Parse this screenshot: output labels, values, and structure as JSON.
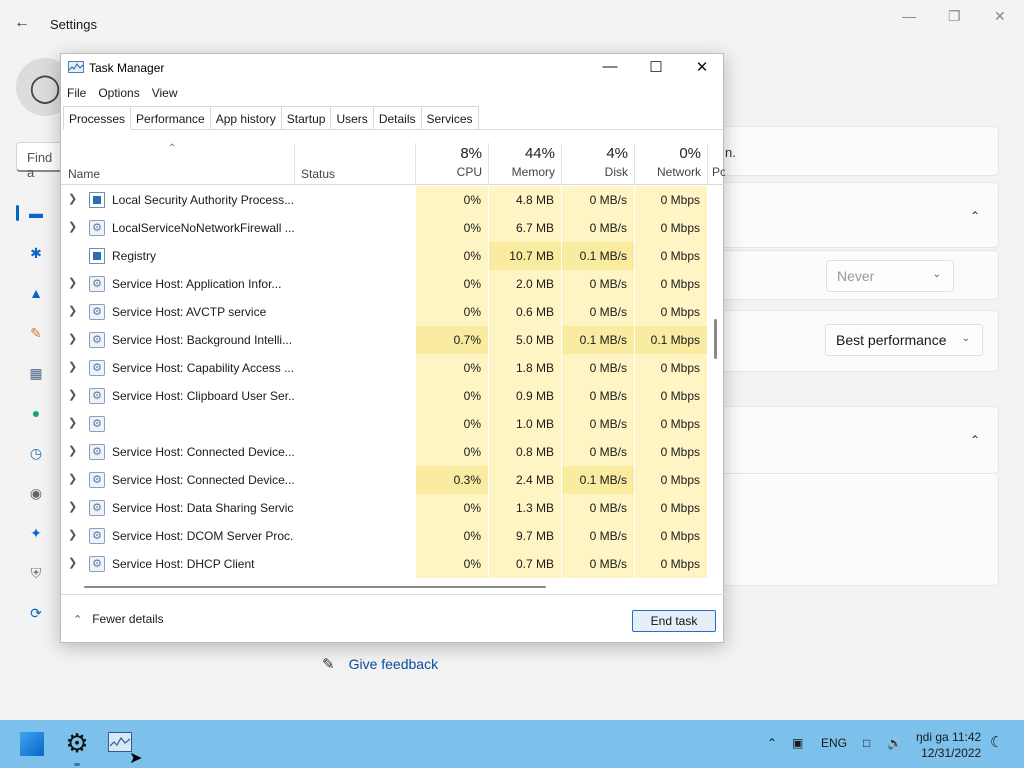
{
  "settings": {
    "title": "Settings",
    "find_placeholder": "Find a",
    "card_partial_text": "n.",
    "dropdown_never": "Never",
    "dropdown_performance": "Best performance",
    "feedback": "Give feedback"
  },
  "taskmanager": {
    "title": "Task Manager",
    "menu": [
      "File",
      "Options",
      "View"
    ],
    "tabs": [
      "Processes",
      "Performance",
      "App history",
      "Startup",
      "Users",
      "Details",
      "Services"
    ],
    "columns": {
      "name": "Name",
      "status": "Status",
      "cpu": {
        "pct": "8%",
        "label": "CPU"
      },
      "memory": {
        "pct": "44%",
        "label": "Memory"
      },
      "disk": {
        "pct": "4%",
        "label": "Disk"
      },
      "network": {
        "pct": "0%",
        "label": "Network"
      },
      "power": "Po"
    },
    "rows": [
      {
        "expand": true,
        "icon": "window",
        "name": "Local Security Authority Process...",
        "cpu": "0%",
        "mem": "4.8 MB",
        "disk": "0 MB/s",
        "net": "0 Mbps"
      },
      {
        "expand": true,
        "icon": "gear",
        "name": "LocalServiceNoNetworkFirewall ...",
        "cpu": "0%",
        "mem": "6.7 MB",
        "disk": "0 MB/s",
        "net": "0 Mbps"
      },
      {
        "expand": false,
        "icon": "window",
        "name": "Registry",
        "cpu": "0%",
        "mem": "10.7 MB",
        "disk": "0.1 MB/s",
        "net": "0 Mbps"
      },
      {
        "expand": true,
        "icon": "gear",
        "name": "Service Host: Application Infor...",
        "cpu": "0%",
        "mem": "2.0 MB",
        "disk": "0 MB/s",
        "net": "0 Mbps"
      },
      {
        "expand": true,
        "icon": "gear",
        "name": "Service Host: AVCTP service",
        "cpu": "0%",
        "mem": "0.6 MB",
        "disk": "0 MB/s",
        "net": "0 Mbps"
      },
      {
        "expand": true,
        "icon": "gear",
        "name": "Service Host: Background Intelli...",
        "cpu": "0.7%",
        "mem": "5.0 MB",
        "disk": "0.1 MB/s",
        "net": "0.1 Mbps"
      },
      {
        "expand": true,
        "icon": "gear",
        "name": "Service Host: Capability Access ...",
        "cpu": "0%",
        "mem": "1.8 MB",
        "disk": "0 MB/s",
        "net": "0 Mbps"
      },
      {
        "expand": true,
        "icon": "gear",
        "name": "Service Host: Clipboard User Ser...",
        "cpu": "0%",
        "mem": "0.9 MB",
        "disk": "0 MB/s",
        "net": "0 Mbps"
      },
      {
        "expand": true,
        "icon": "gear",
        "name": "",
        "cpu": "0%",
        "mem": "1.0 MB",
        "disk": "0 MB/s",
        "net": "0 Mbps"
      },
      {
        "expand": true,
        "icon": "gear",
        "name": "Service Host: Connected Device...",
        "cpu": "0%",
        "mem": "0.8 MB",
        "disk": "0 MB/s",
        "net": "0 Mbps"
      },
      {
        "expand": true,
        "icon": "gear",
        "name": "Service Host: Connected Device...",
        "cpu": "0.3%",
        "mem": "2.4 MB",
        "disk": "0.1 MB/s",
        "net": "0 Mbps"
      },
      {
        "expand": true,
        "icon": "gear",
        "name": "Service Host: Data Sharing Service",
        "cpu": "0%",
        "mem": "1.3 MB",
        "disk": "0 MB/s",
        "net": "0 Mbps"
      },
      {
        "expand": true,
        "icon": "gear",
        "name": "Service Host: DCOM Server Proc...",
        "cpu": "0%",
        "mem": "9.7 MB",
        "disk": "0 MB/s",
        "net": "0 Mbps"
      },
      {
        "expand": true,
        "icon": "gear",
        "name": "Service Host: DHCP Client",
        "cpu": "0%",
        "mem": "0.7 MB",
        "disk": "0 MB/s",
        "net": "0 Mbps"
      }
    ],
    "fewer_details": "Fewer details",
    "end_task": "End task"
  },
  "taskbar": {
    "lang": "ENG",
    "time": "ŋdi ga 11:42",
    "date": "12/31/2022"
  }
}
